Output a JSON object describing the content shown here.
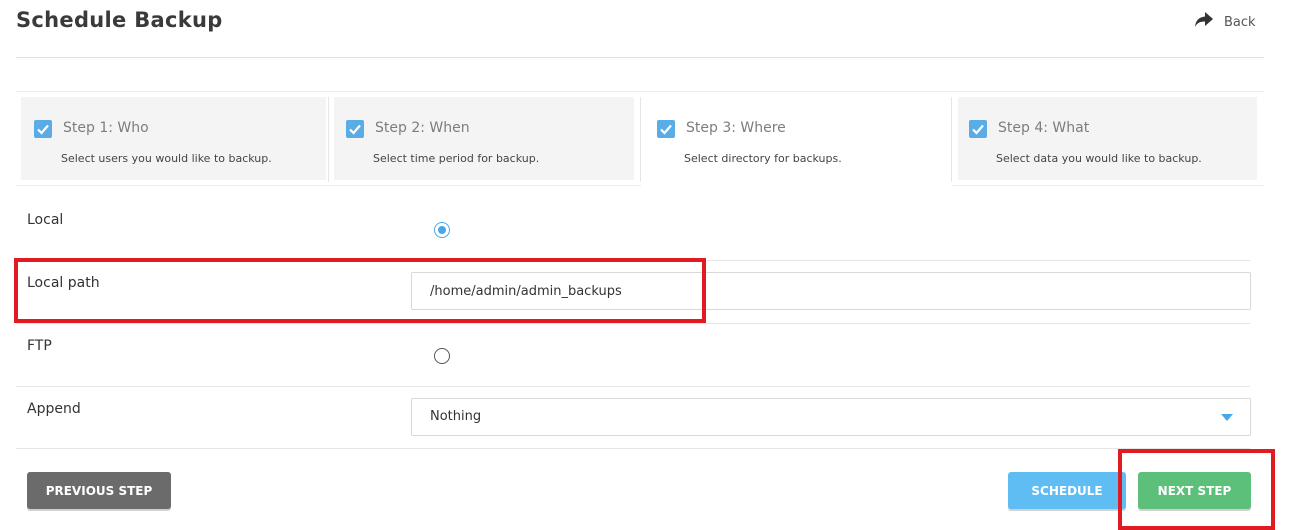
{
  "header": {
    "title": "Schedule Backup",
    "back_label": "Back"
  },
  "steps": [
    {
      "title": "Step 1: Who",
      "description": "Select users you would like to backup.",
      "checked": true
    },
    {
      "title": "Step 2: When",
      "description": "Select time period for backup.",
      "checked": true
    },
    {
      "title": "Step 3: Where",
      "description": "Select directory for backups.",
      "checked": true,
      "active": true
    },
    {
      "title": "Step 4: What",
      "description": "Select data you would like to backup.",
      "checked": true
    }
  ],
  "form": {
    "local_label": "Local",
    "local_selected": true,
    "local_path_label": "Local path",
    "local_path_value": "/home/admin/admin_backups",
    "ftp_label": "FTP",
    "ftp_selected": false,
    "append_label": "Append",
    "append_value": "Nothing"
  },
  "buttons": {
    "previous": "PREVIOUS STEP",
    "schedule": "SCHEDULE",
    "next": "NEXT STEP"
  },
  "colors": {
    "accent_blue": "#4aa6ea",
    "schedule_button": "#5fbdf4",
    "next_button": "#5cc07b",
    "previous_button": "#6b6b6b",
    "highlight": "#e01b22"
  },
  "icons": {
    "back": "share-arrow-icon",
    "step_check": "checkbox-checked-icon",
    "select_caret": "caret-down-icon"
  }
}
